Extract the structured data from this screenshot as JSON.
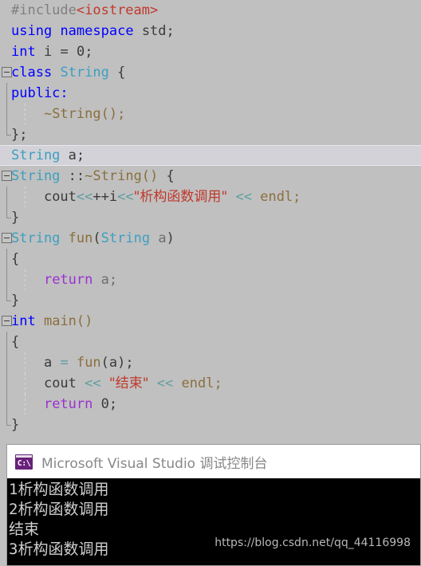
{
  "editor": {
    "background_color": "#c0c0c0",
    "current_line_highlight_color": "#d2d2d8",
    "lines": [
      {
        "id": "l1",
        "text": "#include<iostream>"
      },
      {
        "id": "l2",
        "text": "using namespace std;"
      },
      {
        "id": "l3",
        "text": "int i = 0;"
      },
      {
        "id": "l4",
        "text": "class String {"
      },
      {
        "id": "l5",
        "text": "public:"
      },
      {
        "id": "l6",
        "text": "    ~String();"
      },
      {
        "id": "l7",
        "text": "};"
      },
      {
        "id": "l8",
        "text": "String a;"
      },
      {
        "id": "l9",
        "text": "String ::~String() {"
      },
      {
        "id": "l10",
        "text": "    cout<<++i<<\"析构函数调用\" << endl;"
      },
      {
        "id": "l11",
        "text": "}"
      },
      {
        "id": "l12",
        "text": "String fun(String a)"
      },
      {
        "id": "l13",
        "text": "{"
      },
      {
        "id": "l14",
        "text": "    return a;"
      },
      {
        "id": "l15",
        "text": "}"
      },
      {
        "id": "l16",
        "text": "int main()"
      },
      {
        "id": "l17",
        "text": "{"
      },
      {
        "id": "l18",
        "text": "    a = fun(a);"
      },
      {
        "id": "l19",
        "text": "    cout << \"结束\" << endl;"
      },
      {
        "id": "l20",
        "text": "    return 0;"
      },
      {
        "id": "l21",
        "text": "}"
      }
    ],
    "tokens": {
      "preprocessor": "#include",
      "include_target": "<iostream>",
      "kw_using": "using",
      "kw_namespace": "namespace",
      "id_std": "std;",
      "kw_int": "int",
      "id_i": "i",
      "eq": "=",
      "zero": "0;",
      "kw_class": "class",
      "type_String": "String",
      "brace_open": "{",
      "kw_public": "public:",
      "dtor_decl": "~String();",
      "class_close": "};",
      "decl_String": "String",
      "decl_a": "a;",
      "scope": "::",
      "dtor_def": "~String()",
      "cout": "cout",
      "shift": "<<",
      "inc_i": "++i",
      "str_destructor": "\"析构函数调用\"",
      "endl": "endl;",
      "brace_close": "}",
      "fn_fun": "fun",
      "paren_open": "(",
      "param_a": "a",
      "paren_close": ")",
      "kw_return": "return",
      "ret_a": "a;",
      "fn_main": "main()",
      "assign_a": "a",
      "call_fun": "fun",
      "call_arg": "a",
      "call_tail": ");",
      "str_end": "\"结束\"",
      "ret_zero": "0;"
    },
    "current_line_text": "String a;"
  },
  "console": {
    "title": "Microsoft Visual Studio 调试控制台",
    "icon_glyph": "C:\\",
    "icon_color": "#68217a",
    "titlebar_color": "#ffffff",
    "body_color": "#000000",
    "output": [
      "1析构函数调用",
      "2析构函数调用",
      "结束",
      "3析构函数调用"
    ],
    "watermark": "https://blog.csdn.net/qq_44116998"
  }
}
